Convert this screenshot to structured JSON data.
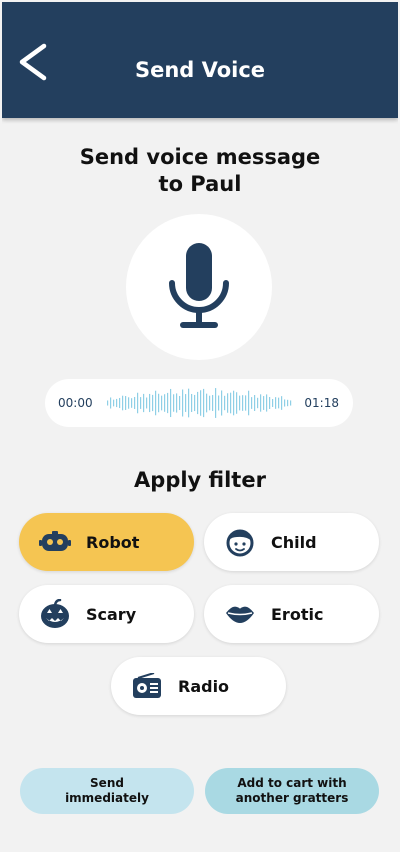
{
  "header": {
    "title": "Send Voice",
    "back_icon": "chevron-left-icon"
  },
  "heading": {
    "line1": "Send voice message",
    "line2": "to Paul"
  },
  "record": {
    "icon": "microphone-icon"
  },
  "player": {
    "current_time": "00:00",
    "duration": "01:18"
  },
  "filters": {
    "title": "Apply filter",
    "items": [
      {
        "label": "Robot",
        "icon": "robot-icon",
        "selected": true
      },
      {
        "label": "Child",
        "icon": "child-face-icon",
        "selected": false
      },
      {
        "label": "Scary",
        "icon": "pumpkin-icon",
        "selected": false
      },
      {
        "label": "Erotic",
        "icon": "lips-icon",
        "selected": false
      },
      {
        "label": "Radio",
        "icon": "radio-icon",
        "selected": false
      }
    ]
  },
  "actions": {
    "send_line1": "Send",
    "send_line2": "immediately",
    "cart_line1": "Add to cart with",
    "cart_line2": "another gratters"
  },
  "colors": {
    "header_bg": "#233f5e",
    "icon": "#233f5e",
    "selected_filter": "#f5c552",
    "wave": "#8fcfe6",
    "button_light": "#c4e4ee",
    "button_alt": "#a9d9e3"
  }
}
